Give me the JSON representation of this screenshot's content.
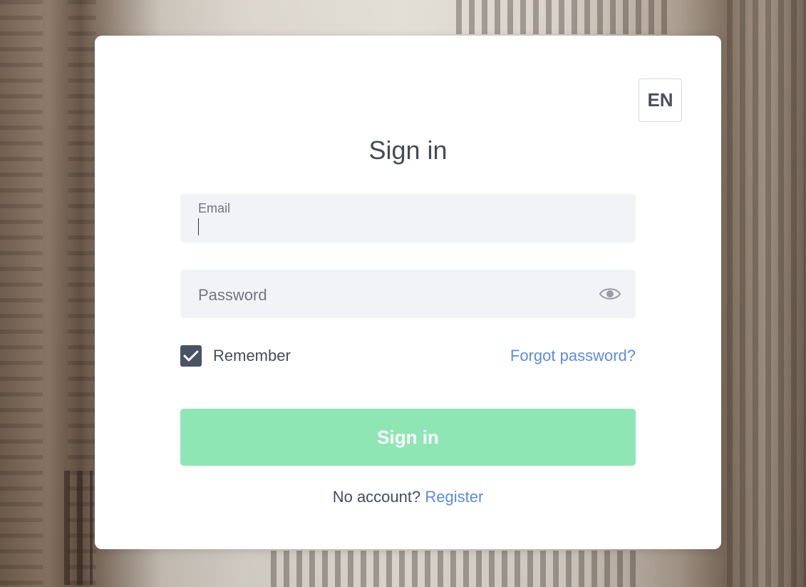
{
  "language_button": {
    "label": "EN"
  },
  "form": {
    "title": "Sign in",
    "email": {
      "label": "Email",
      "value": ""
    },
    "password": {
      "placeholder": "Password",
      "value": ""
    },
    "remember": {
      "label": "Remember",
      "checked": true
    },
    "forgot_password_link": "Forgot password?",
    "submit_label": "Sign in",
    "no_account_text": "No account?",
    "register_link": "Register"
  },
  "icons": {
    "password_toggle": "eye-icon",
    "checkbox_mark": "checkmark-icon"
  },
  "colors": {
    "submit_button": "#8ee6b5",
    "link": "#5b8ae6",
    "checkbox": "#4a5267",
    "input_background": "#f2f3f7"
  }
}
